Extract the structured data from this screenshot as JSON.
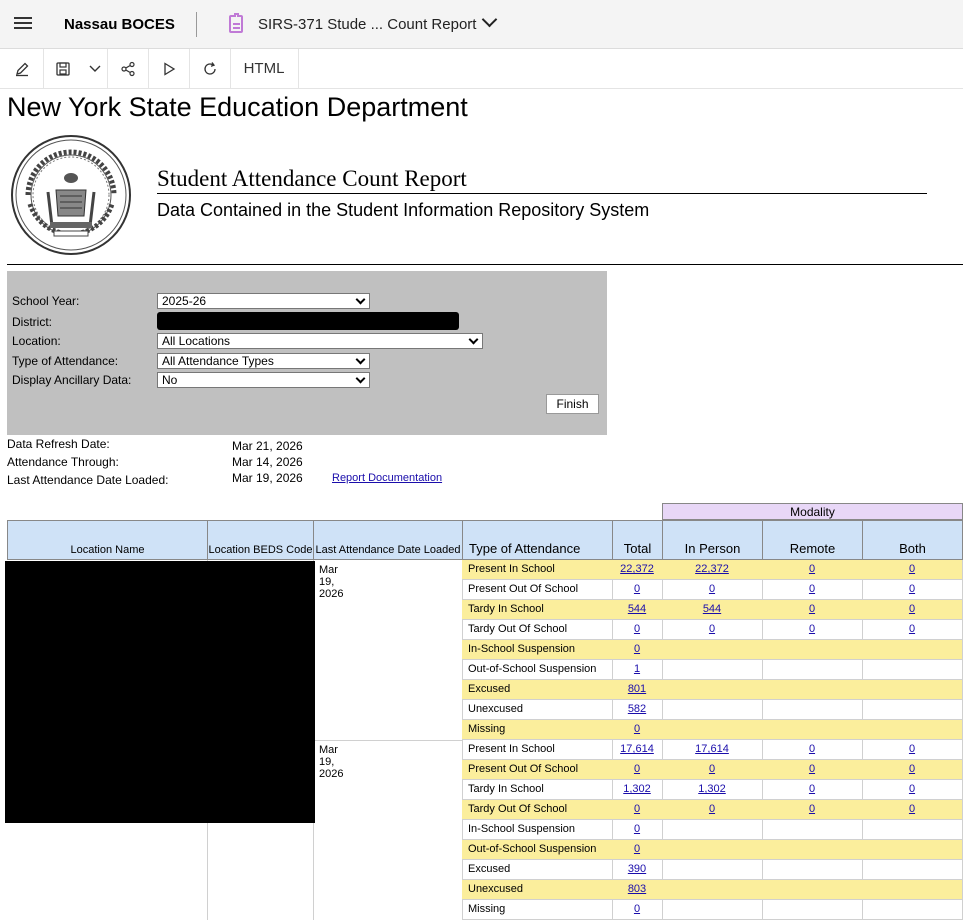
{
  "appbar": {
    "org": "Nassau BOCES",
    "report_title": "SIRS-371 Stude ... Count Report"
  },
  "toolbar": {
    "html_label": "HTML"
  },
  "header": {
    "dept": "New York State Education Department",
    "title": "Student Attendance Count Report",
    "subtitle": "Data Contained in the Student Information Repository System"
  },
  "params": {
    "school_year_label": "School Year:",
    "school_year_value": "2025-26",
    "district_label": "District:",
    "location_label": "Location:",
    "location_value": "All Locations",
    "type_label": "Type of Attendance:",
    "type_value": "All Attendance Types",
    "ancillary_label": "Display Ancillary Data:",
    "ancillary_value": "No",
    "finish_label": "Finish"
  },
  "info": {
    "refresh_label": "Data Refresh Date:",
    "refresh_value": "Mar 21, 2026",
    "through_label": "Attendance Through:",
    "through_value": "Mar 14, 2026",
    "loaded_label": "Last Attendance Date Loaded:",
    "loaded_value": "Mar 19, 2026",
    "doc_link": "Report Documentation"
  },
  "table": {
    "modality_header": "Modality",
    "headers": {
      "location_name": "Location Name",
      "beds_code": "Location BEDS Code",
      "last_loaded": "Last Attendance Date Loaded",
      "type": "Type of Attendance",
      "total": "Total",
      "in_person": "In Person",
      "remote": "Remote",
      "both": "Both"
    },
    "groups": [
      {
        "date": "Mar 19, 2026",
        "rows": [
          {
            "type": "Present In School",
            "total": "22,372",
            "in_person": "22,372",
            "remote": "0",
            "both": "0"
          },
          {
            "type": "Present Out Of School",
            "total": "0",
            "in_person": "0",
            "remote": "0",
            "both": "0"
          },
          {
            "type": "Tardy In School",
            "total": "544",
            "in_person": "544",
            "remote": "0",
            "both": "0"
          },
          {
            "type": "Tardy Out Of School",
            "total": "0",
            "in_person": "0",
            "remote": "0",
            "both": "0"
          },
          {
            "type": "In-School Suspension",
            "total": "0",
            "in_person": "",
            "remote": "",
            "both": ""
          },
          {
            "type": "Out-of-School Suspension",
            "total": "1",
            "in_person": "",
            "remote": "",
            "both": ""
          },
          {
            "type": "Excused",
            "total": "801",
            "in_person": "",
            "remote": "",
            "both": ""
          },
          {
            "type": "Unexcused",
            "total": "582",
            "in_person": "",
            "remote": "",
            "both": ""
          },
          {
            "type": "Missing",
            "total": "0",
            "in_person": "",
            "remote": "",
            "both": ""
          }
        ]
      },
      {
        "date": "Mar 19, 2026",
        "rows": [
          {
            "type": "Present In School",
            "total": "17,614",
            "in_person": "17,614",
            "remote": "0",
            "both": "0"
          },
          {
            "type": "Present Out Of School",
            "total": "0",
            "in_person": "0",
            "remote": "0",
            "both": "0"
          },
          {
            "type": "Tardy In School",
            "total": "1,302",
            "in_person": "1,302",
            "remote": "0",
            "both": "0"
          },
          {
            "type": "Tardy Out Of School",
            "total": "0",
            "in_person": "0",
            "remote": "0",
            "both": "0"
          },
          {
            "type": "In-School Suspension",
            "total": "0",
            "in_person": "",
            "remote": "",
            "both": ""
          },
          {
            "type": "Out-of-School Suspension",
            "total": "0",
            "in_person": "",
            "remote": "",
            "both": ""
          },
          {
            "type": "Excused",
            "total": "390",
            "in_person": "",
            "remote": "",
            "both": ""
          },
          {
            "type": "Unexcused",
            "total": "803",
            "in_person": "",
            "remote": "",
            "both": ""
          },
          {
            "type": "Missing",
            "total": "0",
            "in_person": "",
            "remote": "",
            "both": ""
          }
        ]
      }
    ]
  },
  "colors": {
    "header_blue": "#cfe2f7",
    "modality_purple": "#e8d7f7",
    "row_yellow": "#fbee9c",
    "link": "#1a0dab",
    "panel_gray": "#c0c0c0"
  }
}
